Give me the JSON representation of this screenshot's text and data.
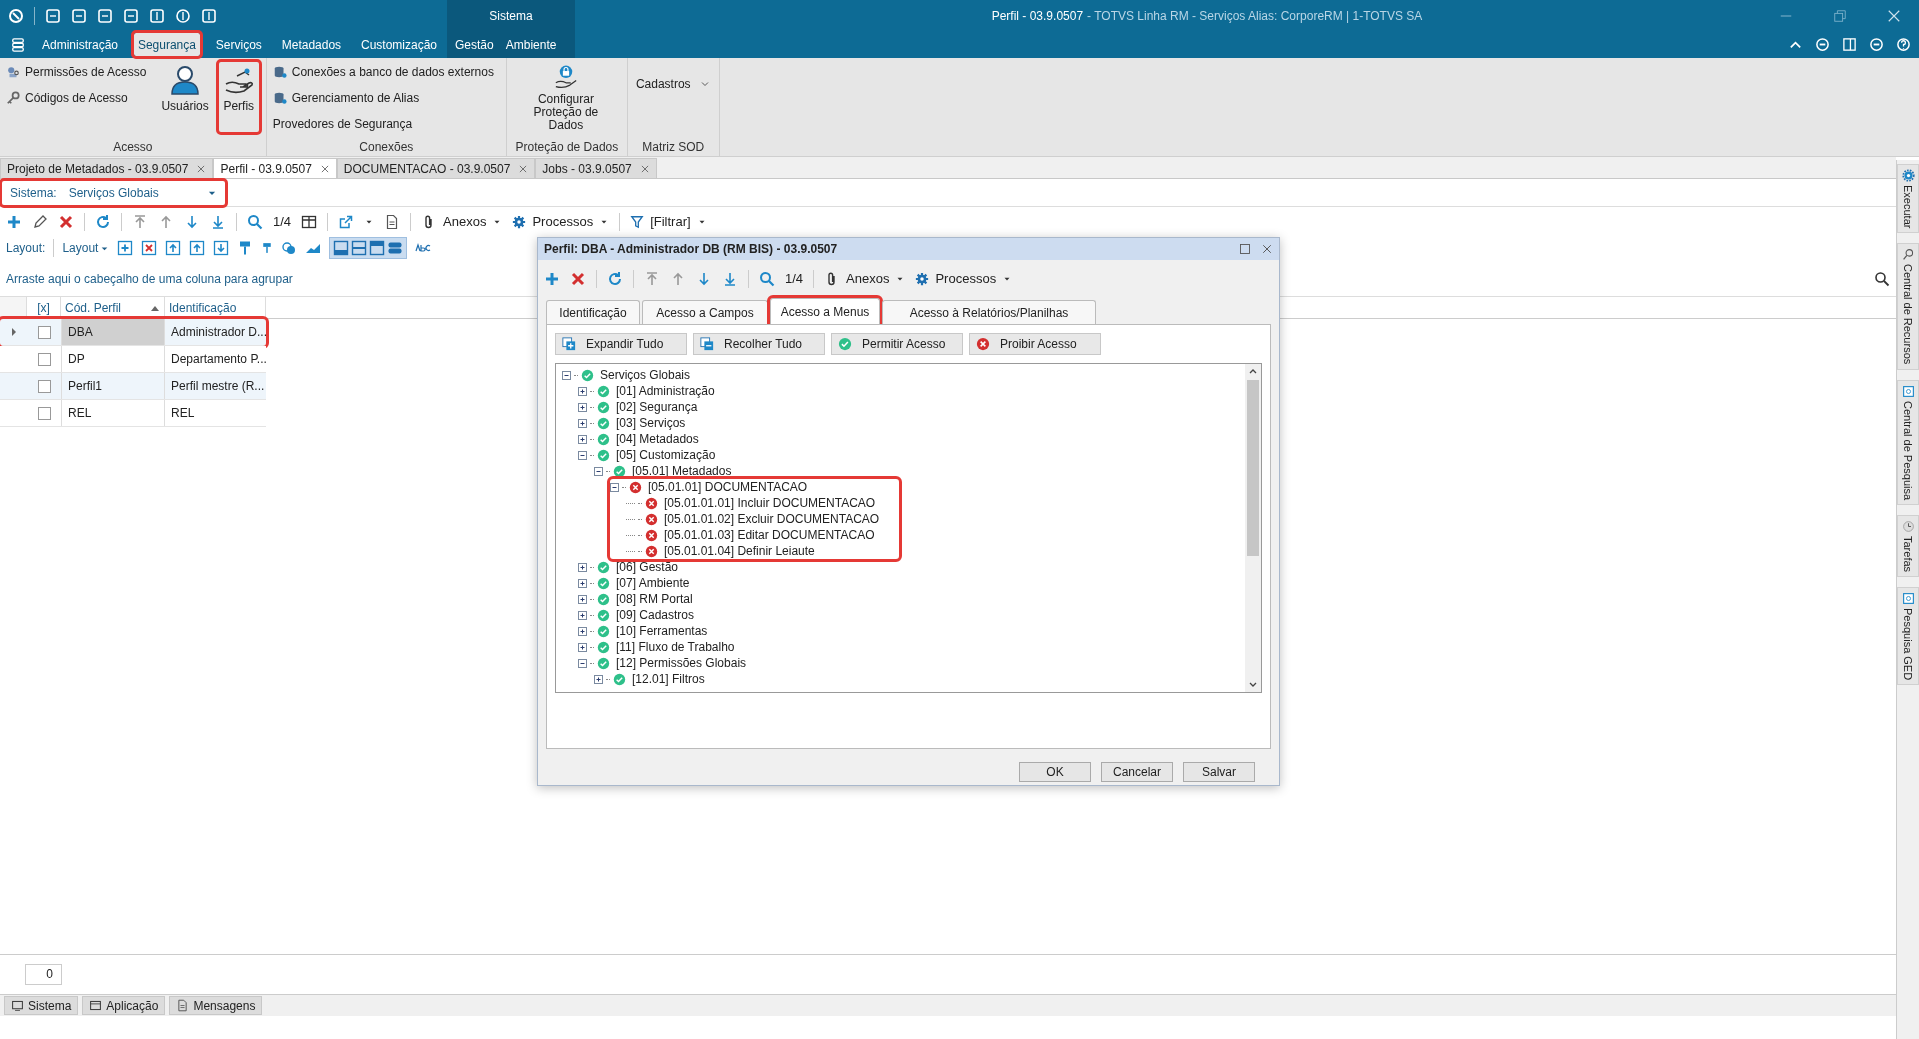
{
  "title_bar": {
    "section": "Sistema",
    "title": "Perfil - 03.9.0507",
    "subtitle": "- TOTVS Linha RM - Serviços  Alias: CorporeRM | 1-TOTVS SA"
  },
  "menu": [
    {
      "label": "Administração",
      "selected": false,
      "contextual": false
    },
    {
      "label": "Segurança",
      "selected": true,
      "contextual": false
    },
    {
      "label": "Serviços",
      "selected": false,
      "contextual": false
    },
    {
      "label": "Metadados",
      "selected": false,
      "contextual": false
    },
    {
      "label": "Customização",
      "selected": false,
      "contextual": false
    },
    {
      "label": "Gestão",
      "selected": false,
      "contextual": true
    },
    {
      "label": "Ambiente",
      "selected": false,
      "contextual": true
    }
  ],
  "ribbon": [
    {
      "label": "Acesso",
      "items": [
        {
          "kind": "small",
          "label": "Permissões de Acesso",
          "highlighted": false
        },
        {
          "kind": "small",
          "label": "Códigos de Acesso",
          "highlighted": false
        },
        {
          "kind": "large",
          "label": "Usuários",
          "highlighted": false
        },
        {
          "kind": "large",
          "label": "Perfis",
          "highlighted": true
        }
      ]
    },
    {
      "label": "Conexões",
      "items": [
        {
          "kind": "small",
          "label": "Conexões a banco de dados externos",
          "highlighted": false
        },
        {
          "kind": "small",
          "label": "Gerenciamento de Alias",
          "highlighted": false
        },
        {
          "kind": "small",
          "label": "Provedores de Segurança",
          "highlighted": false
        }
      ]
    },
    {
      "label": "Proteção de Dados",
      "items": [
        {
          "kind": "large",
          "label": "Configurar Proteção de Dados",
          "highlighted": false
        }
      ]
    },
    {
      "label": "Matriz SOD",
      "items": [
        {
          "kind": "dropdown",
          "label": "Cadastros",
          "highlighted": false
        }
      ]
    }
  ],
  "doc_tabs": [
    {
      "label": "Projeto de Metadados - 03.9.0507",
      "selected": false
    },
    {
      "label": "Perfil - 03.9.0507",
      "selected": true
    },
    {
      "label": "DOCUMENTACAO - 03.9.0507",
      "selected": false
    },
    {
      "label": "Jobs - 03.9.0507",
      "selected": false
    }
  ],
  "system_filter": {
    "label": "Sistema:",
    "value": "Serviços Globais",
    "highlighted": true
  },
  "toolbar": {
    "page": "1/4",
    "attachments": "Anexos",
    "processes": "Processos",
    "filter": "[Filtrar]"
  },
  "layout_bar": {
    "label": "Layout:",
    "menu": "Layout"
  },
  "group_hint": "Arraste aqui o cabeçalho de uma coluna para agrupar",
  "grid": {
    "columns": [
      "[x]",
      "Cód. Perfil",
      "Identificação"
    ],
    "rows": [
      {
        "code": "DBA",
        "identification": "Administrador D...",
        "checked": false,
        "selected": true,
        "highlighted": true
      },
      {
        "code": "DP",
        "identification": "Departamento P...",
        "checked": false,
        "selected": false,
        "highlighted": false
      },
      {
        "code": "Perfil1",
        "identification": "Perfil mestre (R...",
        "checked": false,
        "selected": false,
        "highlighted": false
      },
      {
        "code": "REL",
        "identification": "REL",
        "checked": false,
        "selected": false,
        "highlighted": false
      }
    ]
  },
  "record_count": "0",
  "status_tabs": [
    "Sistema",
    "Aplicação",
    "Mensagens"
  ],
  "side_tabs": [
    "Executar",
    "Central de Recursos",
    "Central de Pesquisa",
    "Tarefas",
    "Pesquisa GED"
  ],
  "dialog": {
    "title": "Perfil: DBA - Administrador DB (RM BIS) - 03.9.0507",
    "toolbar": {
      "page": "1/4",
      "attachments": "Anexos",
      "processes": "Processos"
    },
    "tabs": [
      {
        "label": "Identificação",
        "selected": false,
        "highlighted": false
      },
      {
        "label": "Acesso a Campos",
        "selected": false,
        "highlighted": false
      },
      {
        "label": "Acesso a Menus",
        "selected": true,
        "highlighted": true
      },
      {
        "label": "Acesso à Relatórios/Planilhas",
        "selected": false,
        "highlighted": false
      }
    ],
    "actions": [
      {
        "label": "Expandir Tudo",
        "kind": "expand"
      },
      {
        "label": "Recolher Tudo",
        "kind": "collapse"
      },
      {
        "label": "Permitir Acesso",
        "kind": "allow"
      },
      {
        "label": "Proibir Acesso",
        "kind": "deny"
      }
    ],
    "tree": [
      {
        "label": "Serviços Globais",
        "allowed": true,
        "expanded": true,
        "highlighted": false,
        "children": [
          {
            "label": "[01] Administração",
            "allowed": true,
            "expanded": false,
            "highlighted": false
          },
          {
            "label": "[02] Segurança",
            "allowed": true,
            "expanded": false,
            "highlighted": false
          },
          {
            "label": "[03] Serviços",
            "allowed": true,
            "expanded": false,
            "highlighted": false
          },
          {
            "label": "[04] Metadados",
            "allowed": true,
            "expanded": false,
            "highlighted": false
          },
          {
            "label": "[05] Customização",
            "allowed": true,
            "expanded": true,
            "highlighted": false,
            "children": [
              {
                "label": "[05.01] Metadados",
                "allowed": true,
                "expanded": true,
                "highlighted": false,
                "children": [
                  {
                    "label": "[05.01.01] DOCUMENTACAO",
                    "allowed": false,
                    "expanded": true,
                    "highlighted": true,
                    "children": [
                      {
                        "label": "[05.01.01.01] Incluir DOCUMENTACAO",
                        "allowed": false
                      },
                      {
                        "label": "[05.01.01.02] Excluir DOCUMENTACAO",
                        "allowed": false
                      },
                      {
                        "label": "[05.01.01.03] Editar DOCUMENTACAO",
                        "allowed": false
                      },
                      {
                        "label": "[05.01.01.04] Definir Leiaute",
                        "allowed": false
                      }
                    ]
                  }
                ]
              }
            ]
          },
          {
            "label": "[06] Gestão",
            "allowed": true,
            "expanded": false,
            "highlighted": false
          },
          {
            "label": "[07] Ambiente",
            "allowed": true,
            "expanded": false,
            "highlighted": false
          },
          {
            "label": "[08] RM Portal",
            "allowed": true,
            "expanded": false,
            "highlighted": false
          },
          {
            "label": "[09] Cadastros",
            "allowed": true,
            "expanded": false,
            "highlighted": false
          },
          {
            "label": "[10] Ferramentas",
            "allowed": true,
            "expanded": false,
            "highlighted": false
          },
          {
            "label": "[11] Fluxo de Trabalho",
            "allowed": true,
            "expanded": false,
            "highlighted": false
          },
          {
            "label": "[12] Permissões Globais",
            "allowed": true,
            "expanded": true,
            "highlighted": false,
            "children": [
              {
                "label": "[12.01] Filtros",
                "allowed": true,
                "expanded": false,
                "highlighted": false
              }
            ]
          }
        ]
      }
    ],
    "buttons": [
      "OK",
      "Cancelar",
      "Salvar"
    ]
  }
}
